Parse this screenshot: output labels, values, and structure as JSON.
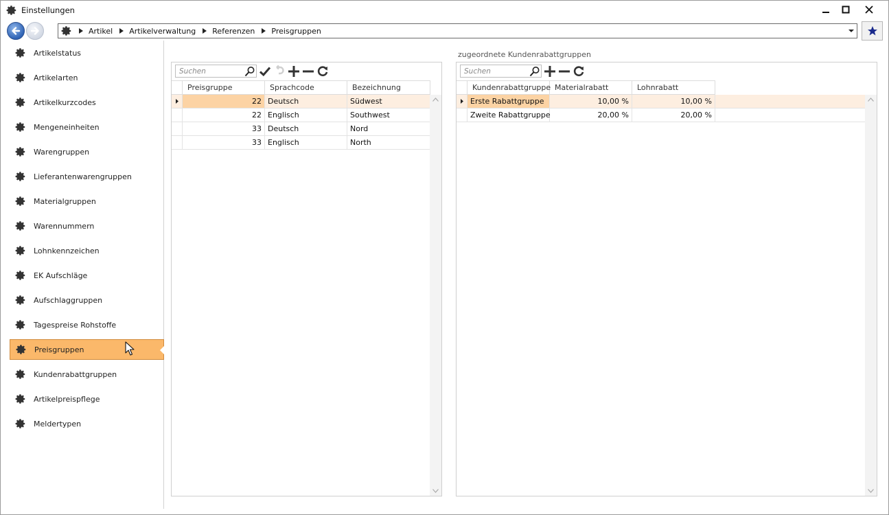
{
  "window": {
    "title": "Einstellungen"
  },
  "breadcrumb": [
    "Artikel",
    "Artikelverwaltung",
    "Referenzen",
    "Preisgruppen"
  ],
  "sidebar": {
    "items": [
      {
        "label": "Artikelstatus"
      },
      {
        "label": "Artikelarten"
      },
      {
        "label": "Artikelkurzcodes"
      },
      {
        "label": "Mengeneinheiten"
      },
      {
        "label": "Warengruppen"
      },
      {
        "label": "Lieferantenwarengruppen"
      },
      {
        "label": "Materialgruppen"
      },
      {
        "label": "Warennummern"
      },
      {
        "label": "Lohnkennzeichen"
      },
      {
        "label": "EK Aufschläge"
      },
      {
        "label": "Aufschlaggruppen"
      },
      {
        "label": "Tagespreise Rohstoffe"
      },
      {
        "label": "Preisgruppen",
        "active": true
      },
      {
        "label": "Kundenrabattgruppen"
      },
      {
        "label": "Artikelpreispflege"
      },
      {
        "label": "Meldertypen"
      }
    ]
  },
  "left_grid": {
    "search_placeholder": "Suchen",
    "columns": [
      "Preisgruppe",
      "Sprachcode",
      "Bezeichnung"
    ],
    "rows": [
      {
        "preisgruppe": "22",
        "sprachcode": "Deutsch",
        "bezeichnung": "Südwest",
        "selected": true
      },
      {
        "preisgruppe": "22",
        "sprachcode": "Englisch",
        "bezeichnung": "Southwest"
      },
      {
        "preisgruppe": "33",
        "sprachcode": "Deutsch",
        "bezeichnung": "Nord"
      },
      {
        "preisgruppe": "33",
        "sprachcode": "Englisch",
        "bezeichnung": "North"
      }
    ]
  },
  "right_grid": {
    "title": "zugeordnete Kundenrabattgruppen",
    "search_placeholder": "Suchen",
    "columns": [
      "Kundenrabattgruppe",
      "Materialrabatt",
      "Lohnrabatt"
    ],
    "rows": [
      {
        "gruppe": "Erste Rabattgruppe",
        "materialrabatt": "10,00 %",
        "lohnrabatt": "10,00 %",
        "selected": true
      },
      {
        "gruppe": "Zweite Rabattgruppe",
        "materialrabatt": "20,00 %",
        "lohnrabatt": "20,00 %"
      }
    ]
  },
  "colors": {
    "accent": "#fbb86a",
    "selected_row": "#fdeee0",
    "current_cell": "#fcd3a4",
    "nav_blue": "#2f63b5",
    "star": "#1a2a8c"
  },
  "icons": {
    "app": "gear-icon",
    "save": "checkmark-icon",
    "undo": "undo-icon",
    "add": "plus-icon",
    "remove": "minus-icon",
    "refresh": "refresh-icon",
    "favorite": "star-icon"
  }
}
